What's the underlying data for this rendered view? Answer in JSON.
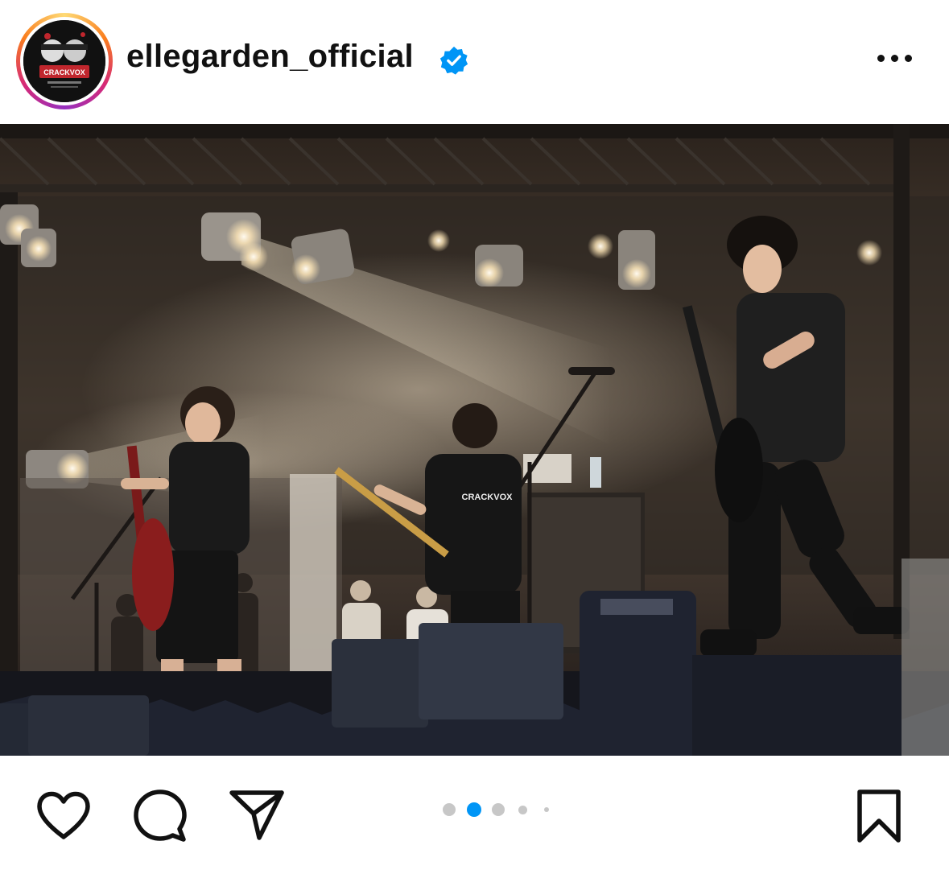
{
  "post": {
    "username": "ellegarden_official",
    "verified": true,
    "avatar_text": "CRACKVOX",
    "photo_description_icon": "concert-stage-photo",
    "shirt_text": "CRACKVOX"
  },
  "carousel": {
    "count": 5,
    "active_index": 1
  },
  "colors": {
    "accent": "#0095f6",
    "icon": "#111111",
    "dot_active": "#0095f6",
    "dot_inactive": "#c7c7c7"
  },
  "icons": [
    "like-heart-icon",
    "comment-icon",
    "share-icon",
    "bookmark-icon",
    "more-options-icon",
    "verified-badge-icon"
  ]
}
